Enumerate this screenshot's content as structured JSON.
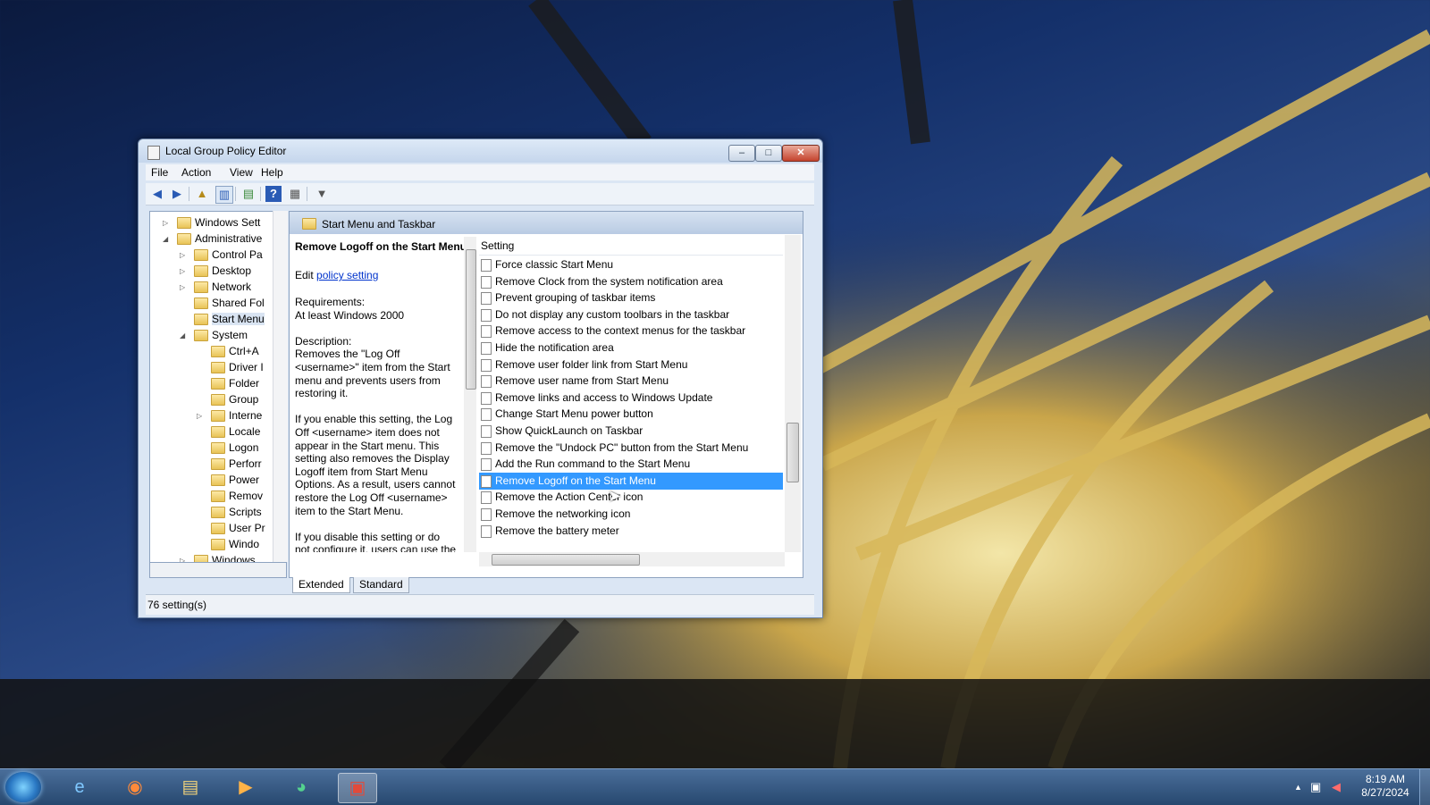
{
  "window": {
    "title": "Local Group Policy Editor",
    "controls": {
      "minimize": "–",
      "maximize": "□",
      "close": "✕"
    }
  },
  "menubar": [
    "File",
    "Action",
    "View",
    "Help"
  ],
  "toolbar": {
    "icons": [
      "back-icon",
      "forward-icon",
      "up-folder-icon",
      "show-hide-tree-icon",
      "export-list-icon",
      "help-icon",
      "properties-icon",
      "filter-icon"
    ]
  },
  "tree": [
    {
      "label": "Windows Sett",
      "indent": 0,
      "expander": "▷"
    },
    {
      "label": "Administrative",
      "indent": 0,
      "expander": "◢"
    },
    {
      "label": "Control Pa",
      "indent": 1,
      "expander": "▷"
    },
    {
      "label": "Desktop",
      "indent": 1,
      "expander": "▷"
    },
    {
      "label": "Network",
      "indent": 1,
      "expander": "▷"
    },
    {
      "label": "Shared Fol",
      "indent": 1,
      "expander": ""
    },
    {
      "label": "Start Menu",
      "indent": 1,
      "expander": "",
      "selected": true
    },
    {
      "label": "System",
      "indent": 1,
      "expander": "◢"
    },
    {
      "label": "Ctrl+A",
      "indent": 2,
      "expander": ""
    },
    {
      "label": "Driver I",
      "indent": 2,
      "expander": ""
    },
    {
      "label": "Folder",
      "indent": 2,
      "expander": ""
    },
    {
      "label": "Group",
      "indent": 2,
      "expander": ""
    },
    {
      "label": "Interne",
      "indent": 2,
      "expander": "▷"
    },
    {
      "label": "Locale",
      "indent": 2,
      "expander": ""
    },
    {
      "label": "Logon",
      "indent": 2,
      "expander": ""
    },
    {
      "label": "Perforr",
      "indent": 2,
      "expander": ""
    },
    {
      "label": "Power",
      "indent": 2,
      "expander": ""
    },
    {
      "label": "Remov",
      "indent": 2,
      "expander": ""
    },
    {
      "label": "Scripts",
      "indent": 2,
      "expander": ""
    },
    {
      "label": "User Pr",
      "indent": 2,
      "expander": ""
    },
    {
      "label": "Windo",
      "indent": 2,
      "expander": ""
    },
    {
      "label": "Windows",
      "indent": 1,
      "expander": "▷"
    }
  ],
  "panel": {
    "header": "Start Menu and Taskbar",
    "description": {
      "title": "Remove Logoff on the Start Menu",
      "edit_prefix": "Edit",
      "edit_link": "policy setting",
      "body": "Requirements:\nAt least Windows 2000\n\nDescription:\nRemoves the \"Log Off <username>\" item from the Start menu and prevents users from restoring it.\n\nIf you enable this setting, the Log Off <username> item does not appear in the Start menu. This setting also removes the Display Logoff item from Start Menu Options. As a result, users cannot restore the Log Off <username> item to the Start Menu.\n\nIf you disable this setting or do not configure it, users can use the"
    },
    "column_header": "Setting",
    "settings": [
      "Force classic Start Menu",
      "Remove Clock from the system notification area",
      "Prevent grouping of taskbar items",
      "Do not display any custom toolbars in the taskbar",
      "Remove access to the context menus for the taskbar",
      "Hide the notification area",
      "Remove user folder link from Start Menu",
      "Remove user name from Start Menu",
      "Remove links and access to Windows Update",
      "Change Start Menu power button",
      "Show QuickLaunch on Taskbar",
      "Remove the \"Undock PC\" button from the Start Menu",
      "Add the Run command to the Start Menu",
      "Remove Logoff on the Start Menu",
      "Remove the Action Center icon",
      "Remove the networking icon",
      "Remove the battery meter"
    ],
    "selected_setting": "Remove Logoff on the Start Menu"
  },
  "tabs": [
    "Extended",
    "Standard"
  ],
  "status": "76 setting(s)",
  "taskbar": {
    "apps": [
      {
        "name": "internet-explorer-icon",
        "glyph": "e"
      },
      {
        "name": "firefox-icon",
        "glyph": "◉"
      },
      {
        "name": "file-explorer-icon",
        "glyph": "▤"
      },
      {
        "name": "media-player-icon",
        "glyph": "▶"
      },
      {
        "name": "app-green-icon",
        "glyph": "◕"
      },
      {
        "name": "group-policy-editor-taskbar-icon",
        "glyph": "▣",
        "active": true
      }
    ],
    "time": "8:19 AM",
    "date": "8/27/2024"
  }
}
